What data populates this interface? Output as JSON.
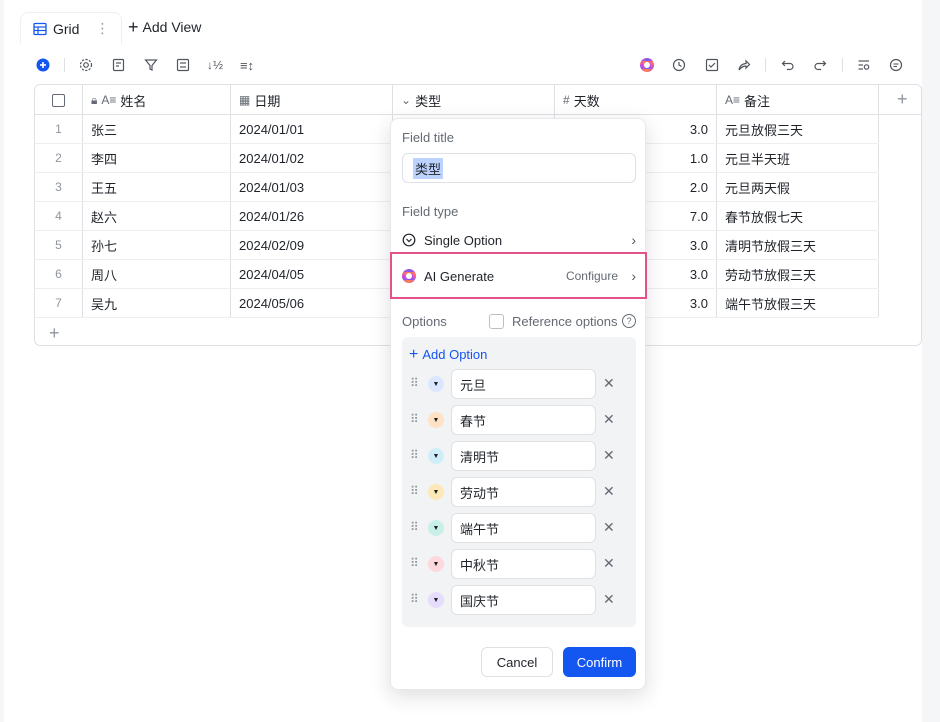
{
  "view_tabs": {
    "active_label": "Grid",
    "add_view_label": "Add View"
  },
  "toolbar": {
    "icons": [
      "add-record-icon",
      "settings-icon",
      "field-icon",
      "filter-icon",
      "group-icon",
      "sort-icon",
      "row-height-icon",
      "ai-icon",
      "history-icon",
      "checklist-icon",
      "share-icon",
      "undo-icon",
      "redo-icon",
      "search-icon",
      "comment-icon"
    ]
  },
  "grid": {
    "columns": [
      {
        "label": "姓名",
        "icon": "text-field-icon",
        "locked": true
      },
      {
        "label": "日期",
        "icon": "date-field-icon"
      },
      {
        "label": "类型",
        "icon": "single-option-icon"
      },
      {
        "label": "天数",
        "icon": "number-field-icon"
      },
      {
        "label": "备注",
        "icon": "text-field-icon"
      }
    ],
    "rows": [
      {
        "n": "1",
        "name": "张三",
        "date": "2024/01/01",
        "days": "3.0",
        "note": "元旦放假三天"
      },
      {
        "n": "2",
        "name": "李四",
        "date": "2024/01/02",
        "days": "1.0",
        "note": "元旦半天班"
      },
      {
        "n": "3",
        "name": "王五",
        "date": "2024/01/03",
        "days": "2.0",
        "note": "元旦两天假"
      },
      {
        "n": "4",
        "name": "赵六",
        "date": "2024/01/26",
        "days": "7.0",
        "note": "春节放假七天"
      },
      {
        "n": "5",
        "name": "孙七",
        "date": "2024/02/09",
        "days": "3.0",
        "note": "清明节放假三天"
      },
      {
        "n": "6",
        "name": "周八",
        "date": "2024/04/05",
        "days": "3.0",
        "note": "劳动节放假三天"
      },
      {
        "n": "7",
        "name": "吴九",
        "date": "2024/05/06",
        "days": "3.0",
        "note": "端午节放假三天"
      }
    ]
  },
  "dialog": {
    "field_title_label": "Field title",
    "field_title_value": "类型",
    "field_type_label": "Field type",
    "single_option_label": "Single Option",
    "ai_generate_label": "AI Generate",
    "configure_label": "Configure",
    "options_label": "Options",
    "reference_options_label": "Reference options",
    "add_option_label": "Add Option",
    "options": [
      {
        "label": "元旦",
        "color": "#dbe6ff"
      },
      {
        "label": "春节",
        "color": "#ffe1c4"
      },
      {
        "label": "清明节",
        "color": "#cfeefa"
      },
      {
        "label": "劳动节",
        "color": "#fde9b6"
      },
      {
        "label": "端午节",
        "color": "#c8f0e8"
      },
      {
        "label": "中秋节",
        "color": "#fdd8dc"
      },
      {
        "label": "国庆节",
        "color": "#e6dcfb"
      }
    ],
    "cancel_label": "Cancel",
    "confirm_label": "Confirm"
  }
}
